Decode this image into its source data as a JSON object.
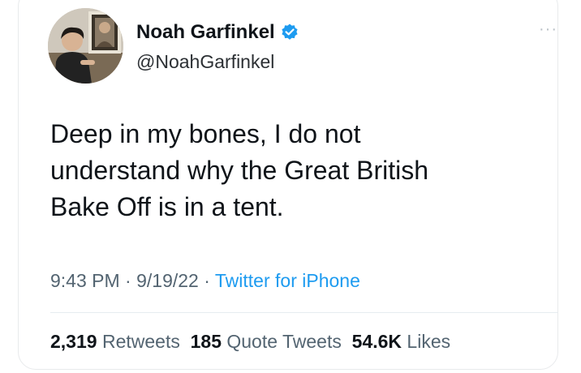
{
  "user": {
    "display_name": "Noah Garfinkel",
    "handle": "@NoahGarfinkel",
    "verified": true,
    "avatar_icon": "profile-photo",
    "verified_icon": "verified-badge-icon"
  },
  "menu": {
    "more_label": "···"
  },
  "tweet": {
    "lines": [
      "Deep in my bones, I do not",
      "understand why the Great British",
      "Bake Off is in a tent."
    ]
  },
  "meta": {
    "time": "9:43 PM",
    "sep1": " · ",
    "date": "9/19/22",
    "sep2": " · ",
    "source": "Twitter for iPhone"
  },
  "stats": {
    "retweets_count": "2,319",
    "retweets_label": "Retweets",
    "quotes_count": "185",
    "quotes_label": "Quote Tweets",
    "likes_count": "54.6K",
    "likes_label": "Likes"
  },
  "colors": {
    "text": "#0f1419",
    "secondary": "#536471",
    "accent": "#1d9bf0"
  }
}
